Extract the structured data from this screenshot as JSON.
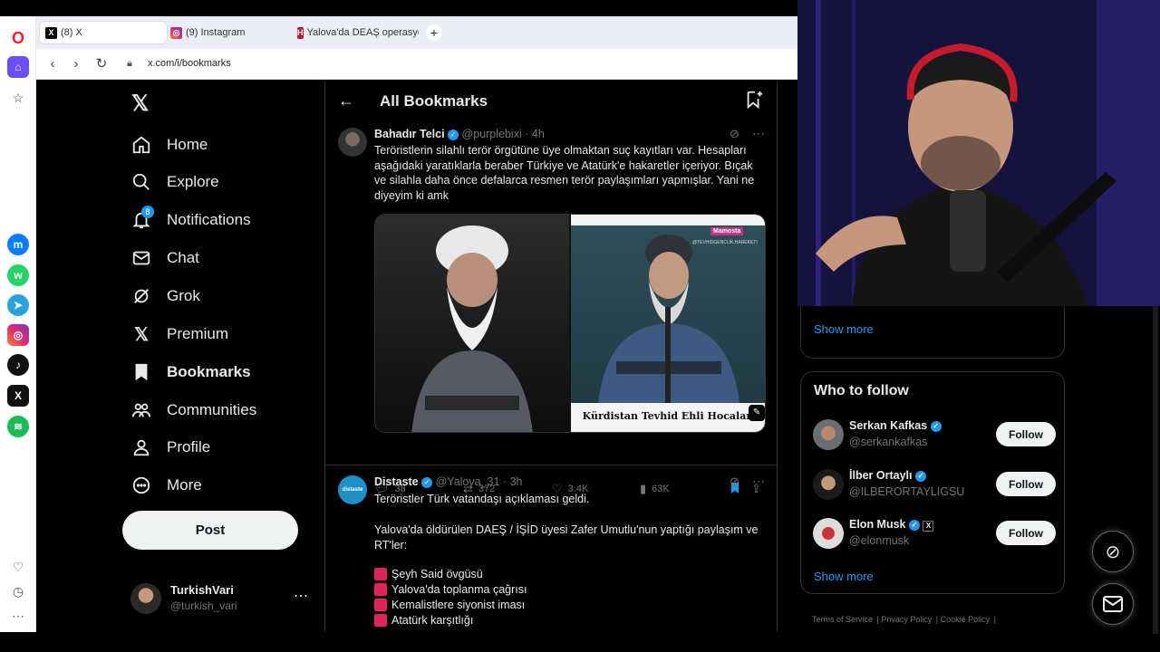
{
  "browser": {
    "tabs": [
      {
        "label": "(8) X",
        "favicon": "x-icon",
        "active": true
      },
      {
        "label": "(9) Instagram",
        "favicon": "instagram-icon",
        "active": false
      },
      {
        "label": "Yalova'da DEAŞ operasyon",
        "favicon": "haberler-icon",
        "active": false
      }
    ],
    "url": "x.com/i/bookmarks",
    "new_tab_symbol": "+"
  },
  "nav": {
    "items": [
      {
        "label": "Home",
        "icon": "home-icon"
      },
      {
        "label": "Explore",
        "icon": "search-icon"
      },
      {
        "label": "Notifications",
        "icon": "bell-icon",
        "badge": "8"
      },
      {
        "label": "Chat",
        "icon": "mail-icon"
      },
      {
        "label": "Grok",
        "icon": "grok-icon"
      },
      {
        "label": "Premium",
        "icon": "x-icon"
      },
      {
        "label": "Bookmarks",
        "icon": "bookmark-icon",
        "active": true
      },
      {
        "label": "Communities",
        "icon": "people-icon"
      },
      {
        "label": "Profile",
        "icon": "person-icon"
      },
      {
        "label": "More",
        "icon": "more-circle-icon"
      }
    ],
    "post_label": "Post",
    "account": {
      "name": "TurkishVari",
      "handle": "@turkish_vari"
    }
  },
  "main": {
    "title": "All Bookmarks",
    "tweets": [
      {
        "name": "Bahadır Telci",
        "handle": "@purplebixi",
        "time": "4h",
        "text": "Teröristlerin silahlı terör örgütüne üye olmaktan suç kayıtları var. Hesapları aşağıdaki yaratıklarla beraber Türkiye ve Atatürk'e hakaretler içeriyor. Bıçak ve silahla daha önce defalarca resmen terör paylaşımları yapmışlar. Yani ne diyeyim ki amk",
        "image_caption": "Kürdistan Tevhid Ehli Hocaları",
        "image_watermark": "Mamosta",
        "image_sub": "@TEVHIDGENCLIK.HAREKETI",
        "stats": {
          "replies": "38",
          "reposts": "372",
          "likes": "3.4K",
          "views": "63K"
        }
      },
      {
        "name": "Distaste",
        "handle": "@Yalova_31",
        "time": "3h",
        "avatar_text": "distaste",
        "line1": "Teröristler Türk vatandaşı açıklaması geldi.",
        "line2": "Yalova'da öldürülen DAEŞ / İŞİD üyesi Zafer Umutlu'nun yaptığı paylaşım ve RT'ler:",
        "bullets": [
          "Şeyh Said övgüsü",
          "Yalova'da toplanma çağrısı",
          "Kemalistlere siyonist iması",
          "Atatürk karşıtlığı"
        ]
      }
    ]
  },
  "right": {
    "show_more_top": "Show more",
    "who_to_follow": "Who to follow",
    "follow_label": "Follow",
    "suggestions": [
      {
        "name": "Serkan Kafkas",
        "handle": "@serkankafkas"
      },
      {
        "name": "İlber Ortaylı",
        "handle": "@ILBERORTAYLIGSU"
      },
      {
        "name": "Elon Musk",
        "handle": "@elonmusk"
      }
    ],
    "show_more_bottom": "Show more",
    "footer": [
      "Terms of Service",
      "Privacy Policy",
      "Cookie Policy"
    ]
  },
  "colors": {
    "accent": "#1d9bf0",
    "background": "#000000",
    "border": "#2f3336",
    "muted": "#71767b",
    "text": "#e7e9ea"
  }
}
